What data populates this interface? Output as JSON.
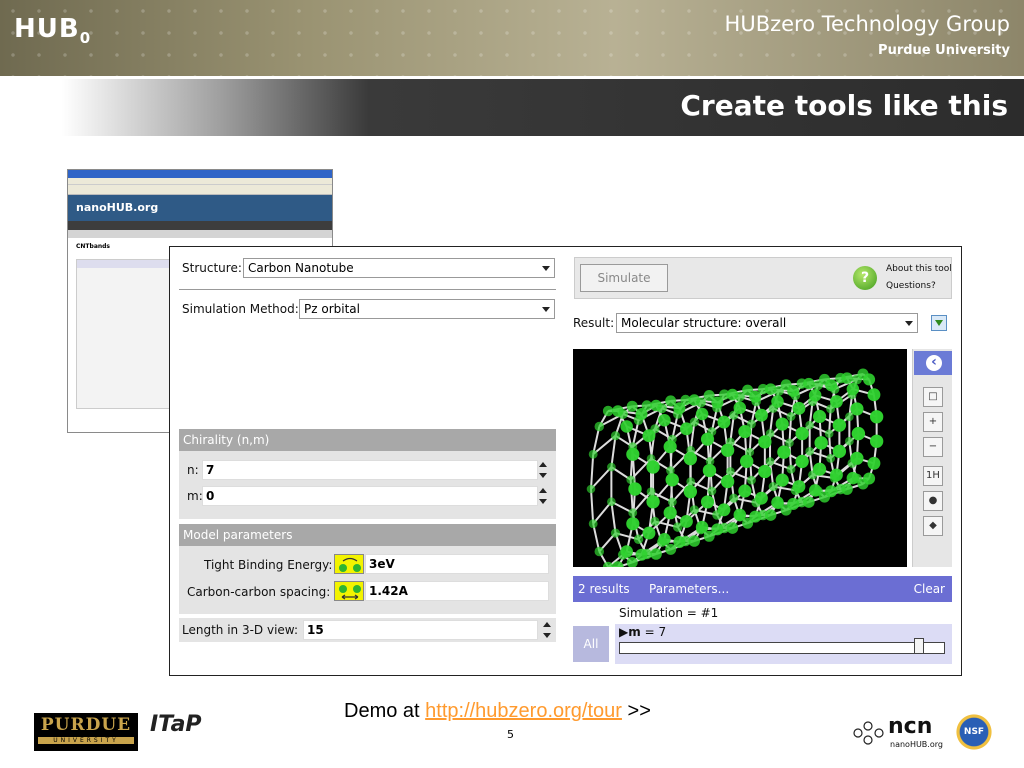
{
  "header": {
    "logo_text": "HUB",
    "logo_sub": "0",
    "group_name": "HUBzero Technology Group",
    "university": "Purdue University",
    "slide_title": "Create tools like this"
  },
  "tool": {
    "structure_label": "Structure:",
    "structure_value": "Carbon Nanotube",
    "method_label": "Simulation Method:",
    "method_value": "Pz orbital",
    "chirality_header": "Chirality (n,m)",
    "n_label": "n:",
    "n_value": "7",
    "m_label": "m:",
    "m_value": "0",
    "model_header": "Model parameters",
    "tb_label": "Tight Binding Energy:",
    "tb_value": "3eV",
    "cc_label": "Carbon-carbon spacing:",
    "cc_value": "1.42A",
    "length_label": "Length in 3-D view:",
    "length_value": "15",
    "simulate_label": "Simulate",
    "about_label": "About this tool",
    "questions_label": "Questions?",
    "result_label": "Result:",
    "result_value": "Molecular structure: overall",
    "toolbar_1h": "1H",
    "results_count": "2 results",
    "parameters_label": "Parameters...",
    "clear_label": "Clear",
    "simulation_label": "Simulation = #1",
    "m_slider_label": "m",
    "m_slider_value": "= 7",
    "slider_fraction": 0.92,
    "all_label": "All"
  },
  "browser_thumb": {
    "site_name": "nanoHUB.org",
    "page_title": "CNTbands"
  },
  "footer": {
    "demo_prefix": "Demo at ",
    "demo_link": "http://hubzero.org/tour",
    "demo_suffix": " >>",
    "page_number": "5",
    "purdue_big": "PURDUE",
    "purdue_small": "UNIVERSITY",
    "itap": "ITaP",
    "ncn": "ncn",
    "ncn_sub": "nanoHUB.org",
    "nsf": "NSF"
  },
  "colors": {
    "accent_blue": "#6b6ed3",
    "link_orange": "#ff9a2e",
    "atom_green": "#2fd12f"
  }
}
